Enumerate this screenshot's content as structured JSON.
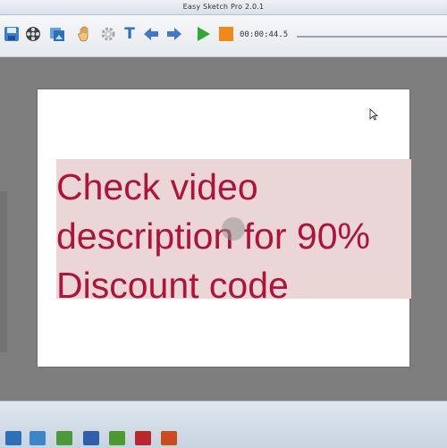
{
  "window": {
    "title": "Easy Sketch Pro 2.0.1"
  },
  "toolbar": {
    "buttons": [
      {
        "name": "save-icon"
      },
      {
        "name": "film-reel-icon"
      },
      {
        "name": "image-icon"
      },
      {
        "name": "hand-icon"
      },
      {
        "name": "gear-icon"
      },
      {
        "name": "text-icon",
        "glyph": "T"
      },
      {
        "name": "arrow-left-icon"
      },
      {
        "name": "arrow-right-icon"
      },
      {
        "name": "play-icon"
      },
      {
        "name": "stop-icon"
      }
    ],
    "timer": "00:00:44.5"
  },
  "slide": {
    "lines": [
      "Check video",
      "description for 90%",
      "Discount code"
    ],
    "text_color": "#b0123a",
    "highlight_color": "#ead6d7"
  },
  "taskbar": {
    "icons": [
      {
        "name": "start-icon",
        "color": "#2d6fb8"
      },
      {
        "name": "taskbar-app-1-icon",
        "color": "#3a86c8"
      },
      {
        "name": "taskbar-app-2-icon",
        "color": "#4a9a3a"
      },
      {
        "name": "taskbar-app-3-icon",
        "color": "#2f5fa8"
      },
      {
        "name": "taskbar-app-4-icon",
        "color": "#4c9a2f"
      },
      {
        "name": "taskbar-app-5-icon",
        "color": "#b8282a"
      },
      {
        "name": "taskbar-app-6-icon",
        "color": "#c84c1c"
      }
    ]
  }
}
